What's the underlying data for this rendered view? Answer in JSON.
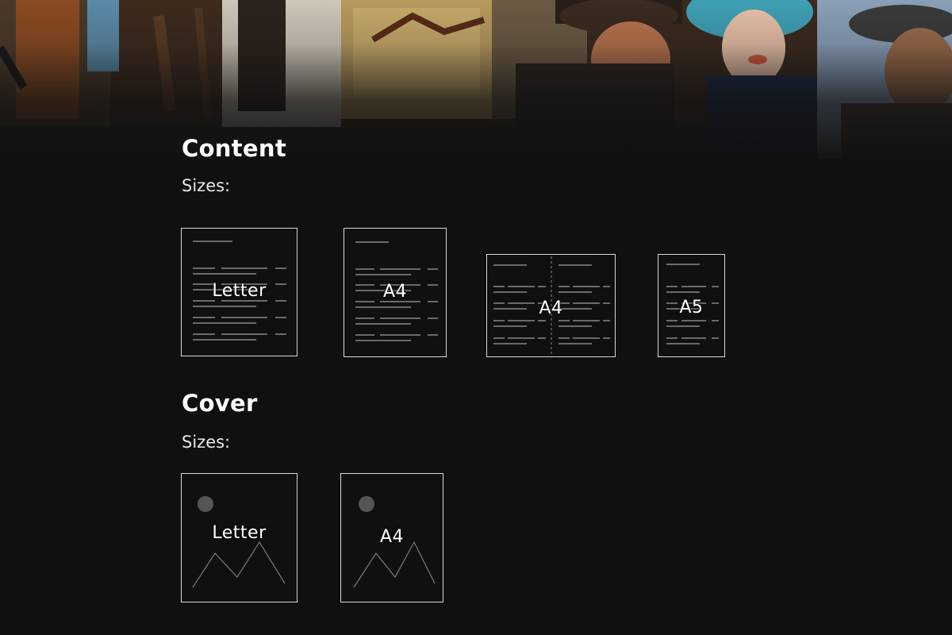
{
  "content_section": {
    "title": "Content",
    "sizes_label": "Sizes:",
    "options": [
      {
        "label": "Letter",
        "icon": "single-page-document-icon"
      },
      {
        "label": "A4",
        "icon": "single-page-document-icon"
      },
      {
        "label": "A4",
        "icon": "two-page-spread-icon"
      },
      {
        "label": "A5",
        "icon": "single-page-document-icon"
      }
    ]
  },
  "cover_section": {
    "title": "Cover",
    "sizes_label": "Sizes:",
    "options": [
      {
        "label": "Letter",
        "icon": "image-cover-icon"
      },
      {
        "label": "A4",
        "icon": "image-cover-icon"
      }
    ]
  },
  "colors": {
    "background": "#101010",
    "card_border": "#d9d9d9",
    "placeholder_line": "#6a6a6a",
    "text": "#ffffff"
  }
}
